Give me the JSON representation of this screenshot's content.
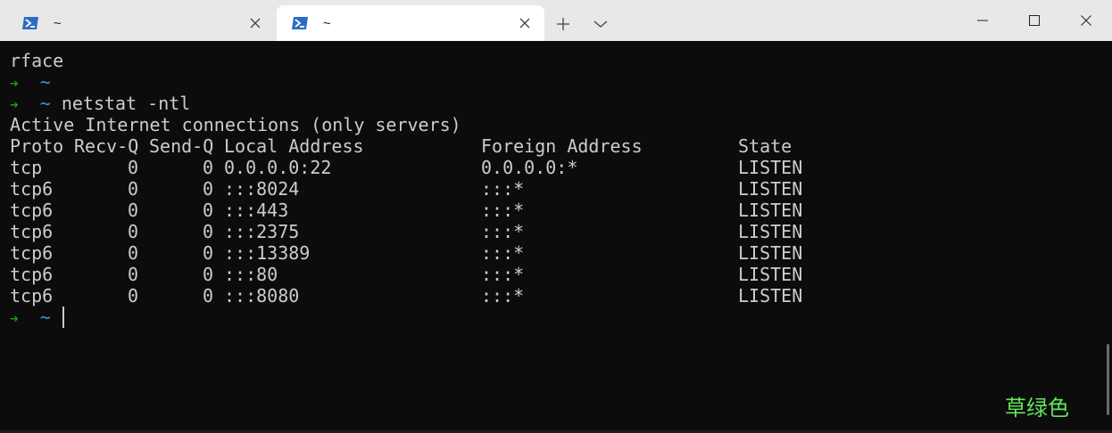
{
  "tabs": [
    {
      "title": "~",
      "icon": "powershell-icon",
      "active": false
    },
    {
      "title": "~",
      "icon": "powershell-icon",
      "active": true
    }
  ],
  "window_controls": {
    "new_tab": "+",
    "dropdown": "⌄"
  },
  "colors": {
    "background": "#0c0c0c",
    "text": "#cccccc",
    "prompt_arrow": "#13a10e",
    "prompt_tilde": "#3a96dd",
    "watermark": "#5fe85a"
  },
  "terminal": {
    "line0": "rface",
    "prompt_arrow": "➜",
    "prompt_tilde": "~",
    "command": "netstat -ntl",
    "header": "Active Internet connections (only servers)",
    "columns": {
      "proto": "Proto",
      "recvq": "Recv-Q",
      "sendq": "Send-Q",
      "local": "Local Address",
      "foreign": "Foreign Address",
      "state": "State"
    },
    "rows": [
      {
        "proto": "tcp",
        "recvq": "0",
        "sendq": "0",
        "local": "0.0.0.0:22",
        "foreign": "0.0.0.0:*",
        "state": "LISTEN"
      },
      {
        "proto": "tcp6",
        "recvq": "0",
        "sendq": "0",
        "local": ":::8024",
        "foreign": ":::*",
        "state": "LISTEN"
      },
      {
        "proto": "tcp6",
        "recvq": "0",
        "sendq": "0",
        "local": ":::443",
        "foreign": ":::*",
        "state": "LISTEN"
      },
      {
        "proto": "tcp6",
        "recvq": "0",
        "sendq": "0",
        "local": ":::2375",
        "foreign": ":::*",
        "state": "LISTEN"
      },
      {
        "proto": "tcp6",
        "recvq": "0",
        "sendq": "0",
        "local": ":::13389",
        "foreign": ":::*",
        "state": "LISTEN"
      },
      {
        "proto": "tcp6",
        "recvq": "0",
        "sendq": "0",
        "local": ":::80",
        "foreign": ":::*",
        "state": "LISTEN"
      },
      {
        "proto": "tcp6",
        "recvq": "0",
        "sendq": "0",
        "local": ":::8080",
        "foreign": ":::*",
        "state": "LISTEN"
      }
    ]
  },
  "watermark": "草绿色"
}
